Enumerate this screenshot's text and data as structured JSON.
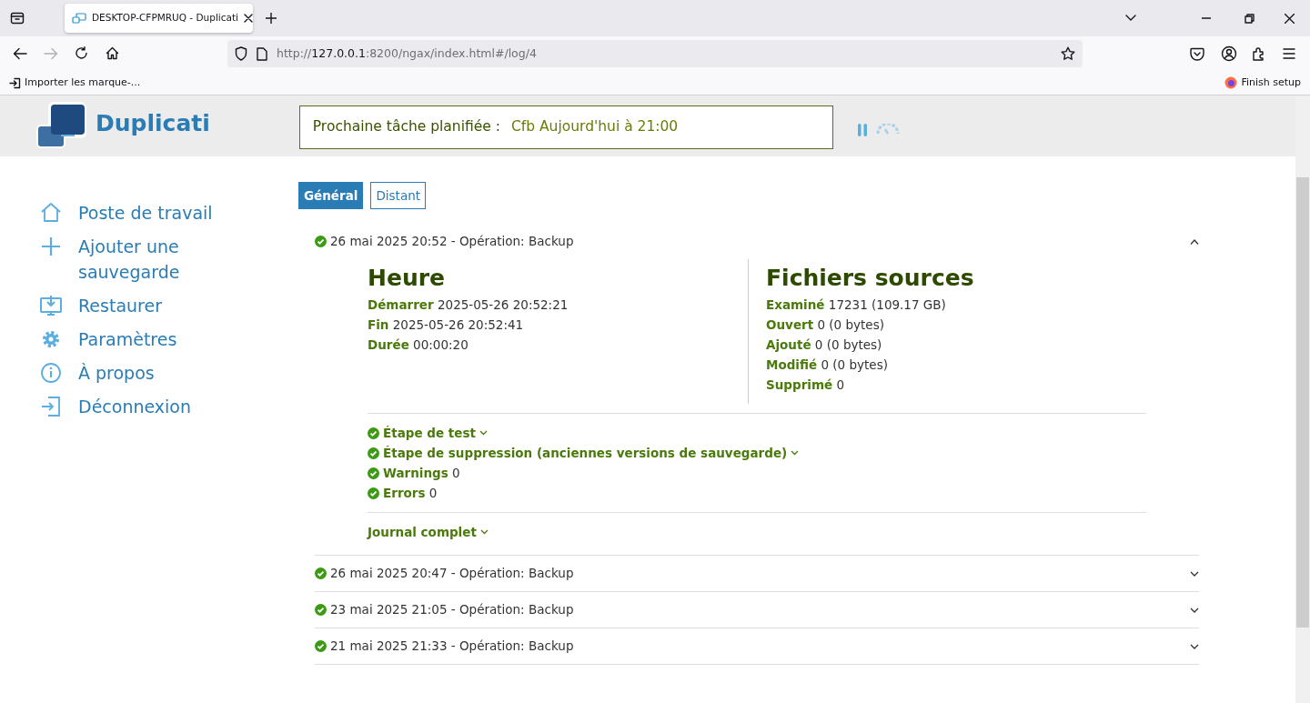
{
  "browser": {
    "tab_title": "DESKTOP-CFPMRUQ - Duplicati",
    "url": {
      "prefix": "http://",
      "host": "127.0.0.1",
      "path": ":8200/ngax/index.html#/log/4"
    },
    "bookmarks": [
      {
        "label": "Importer les marque-..."
      }
    ],
    "finish_setup": "Finish setup"
  },
  "header": {
    "brand": "Duplicati",
    "next_task": {
      "label": "Prochaine tâche planifiée :",
      "value": "Cfb Aujourd'hui à 21:00"
    }
  },
  "sidebar": {
    "items": [
      {
        "label": "Poste de travail",
        "kind": "home"
      },
      {
        "label": "Ajouter une sauvegarde",
        "kind": "add"
      },
      {
        "label": "Restaurer",
        "kind": "restore"
      },
      {
        "label": "Paramètres",
        "kind": "settings"
      },
      {
        "label": "À propos",
        "kind": "info"
      },
      {
        "label": "Déconnexion",
        "kind": "logout"
      }
    ]
  },
  "tabs": [
    {
      "label": "Général",
      "selected": true
    },
    {
      "label": "Distant",
      "selected": false
    }
  ],
  "logs": [
    {
      "title": "26 mai 2025 20:52 - Opération: Backup",
      "success": true,
      "expanded": true,
      "details": {
        "columns": [
          {
            "title": "Heure",
            "fields": [
              {
                "label": "Démarrer",
                "value": "2025-05-26 20:52:21"
              },
              {
                "label": "Fin",
                "value": "2025-05-26 20:52:41"
              },
              {
                "label": "Durée",
                "value": "00:00:20"
              }
            ]
          },
          {
            "title": "Fichiers sources",
            "fields": [
              {
                "label": "Examiné",
                "value": "17231 (109.17 GB)"
              },
              {
                "label": "Ouvert",
                "value": "0 (0 bytes)"
              },
              {
                "label": "Ajouté",
                "value": "0 (0 bytes)"
              },
              {
                "label": "Modifié",
                "value": "0 (0 bytes)"
              },
              {
                "label": "Supprimé",
                "value": "0"
              }
            ]
          }
        ],
        "sections": [
          {
            "kind": "collapsible",
            "label": "Étape de test",
            "success": true,
            "expanded": false
          },
          {
            "kind": "collapsible",
            "label": "Étape de suppression (anciennes versions de sauvegarde)",
            "success": true,
            "expanded": false
          },
          {
            "kind": "count",
            "label": "Warnings",
            "success": true,
            "value": "0"
          },
          {
            "kind": "count",
            "label": "Errors",
            "success": true,
            "value": "0"
          }
        ],
        "journal": {
          "label": "Journal complet",
          "expanded": false
        }
      }
    },
    {
      "title": "26 mai 2025 20:47 - Opération: Backup",
      "success": true,
      "expanded": false
    },
    {
      "title": "23 mai 2025 21:05 - Opération: Backup",
      "success": true,
      "expanded": false
    },
    {
      "title": "21 mai 2025 21:33 - Opération: Backup",
      "success": true,
      "expanded": false
    }
  ]
}
